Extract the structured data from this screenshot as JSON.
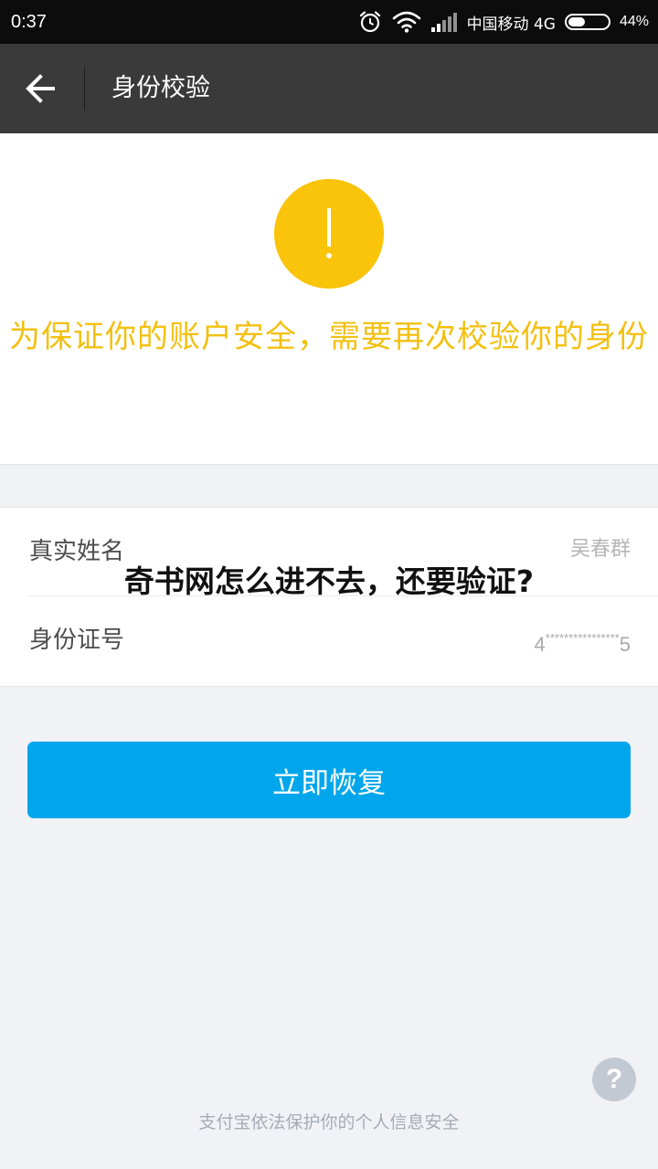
{
  "status_bar": {
    "time": "0:37",
    "carrier": "中国移动 4G",
    "battery_percent": "44%",
    "battery_level": 0.44,
    "icons": [
      "alarm-icon",
      "wifi-icon",
      "signal-icon",
      "battery-icon"
    ]
  },
  "app_bar": {
    "back_icon": "arrow-left-icon",
    "title": "身份校验"
  },
  "warning": {
    "icon": "exclamation-icon",
    "icon_color": "#f9c409",
    "message": "为保证你的账户安全，需要再次校验你的身份",
    "text_color": "#f3c011"
  },
  "form": {
    "name_label": "真实姓名",
    "name_value": "吴春群",
    "id_label": "身份证号",
    "id_value_first": "4",
    "id_value_mask": "****************",
    "id_value_last": "5"
  },
  "overlay": {
    "headline": "奇书网怎么进不去，还要验证?"
  },
  "actions": {
    "restore_label": "立即恢复",
    "button_color": "#00a6eb"
  },
  "help": {
    "icon": "question-icon",
    "symbol": "?"
  },
  "footer": {
    "text": "支付宝依法保护你的个人信息安全"
  }
}
